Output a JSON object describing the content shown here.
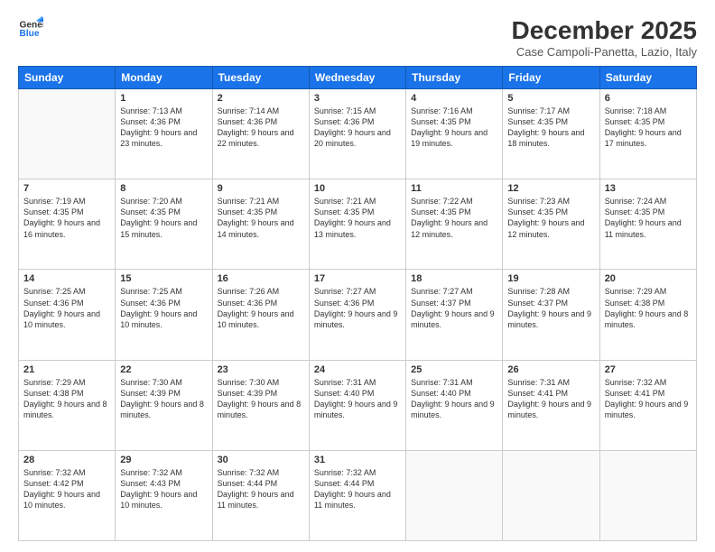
{
  "logo": {
    "line1": "General",
    "line2": "Blue"
  },
  "header": {
    "month": "December 2025",
    "location": "Case Campoli-Panetta, Lazio, Italy"
  },
  "weekdays": [
    "Sunday",
    "Monday",
    "Tuesday",
    "Wednesday",
    "Thursday",
    "Friday",
    "Saturday"
  ],
  "weeks": [
    [
      {
        "day": "",
        "sunrise": "",
        "sunset": "",
        "daylight": ""
      },
      {
        "day": "1",
        "sunrise": "Sunrise: 7:13 AM",
        "sunset": "Sunset: 4:36 PM",
        "daylight": "Daylight: 9 hours and 23 minutes."
      },
      {
        "day": "2",
        "sunrise": "Sunrise: 7:14 AM",
        "sunset": "Sunset: 4:36 PM",
        "daylight": "Daylight: 9 hours and 22 minutes."
      },
      {
        "day": "3",
        "sunrise": "Sunrise: 7:15 AM",
        "sunset": "Sunset: 4:36 PM",
        "daylight": "Daylight: 9 hours and 20 minutes."
      },
      {
        "day": "4",
        "sunrise": "Sunrise: 7:16 AM",
        "sunset": "Sunset: 4:35 PM",
        "daylight": "Daylight: 9 hours and 19 minutes."
      },
      {
        "day": "5",
        "sunrise": "Sunrise: 7:17 AM",
        "sunset": "Sunset: 4:35 PM",
        "daylight": "Daylight: 9 hours and 18 minutes."
      },
      {
        "day": "6",
        "sunrise": "Sunrise: 7:18 AM",
        "sunset": "Sunset: 4:35 PM",
        "daylight": "Daylight: 9 hours and 17 minutes."
      }
    ],
    [
      {
        "day": "7",
        "sunrise": "Sunrise: 7:19 AM",
        "sunset": "Sunset: 4:35 PM",
        "daylight": "Daylight: 9 hours and 16 minutes."
      },
      {
        "day": "8",
        "sunrise": "Sunrise: 7:20 AM",
        "sunset": "Sunset: 4:35 PM",
        "daylight": "Daylight: 9 hours and 15 minutes."
      },
      {
        "day": "9",
        "sunrise": "Sunrise: 7:21 AM",
        "sunset": "Sunset: 4:35 PM",
        "daylight": "Daylight: 9 hours and 14 minutes."
      },
      {
        "day": "10",
        "sunrise": "Sunrise: 7:21 AM",
        "sunset": "Sunset: 4:35 PM",
        "daylight": "Daylight: 9 hours and 13 minutes."
      },
      {
        "day": "11",
        "sunrise": "Sunrise: 7:22 AM",
        "sunset": "Sunset: 4:35 PM",
        "daylight": "Daylight: 9 hours and 12 minutes."
      },
      {
        "day": "12",
        "sunrise": "Sunrise: 7:23 AM",
        "sunset": "Sunset: 4:35 PM",
        "daylight": "Daylight: 9 hours and 12 minutes."
      },
      {
        "day": "13",
        "sunrise": "Sunrise: 7:24 AM",
        "sunset": "Sunset: 4:35 PM",
        "daylight": "Daylight: 9 hours and 11 minutes."
      }
    ],
    [
      {
        "day": "14",
        "sunrise": "Sunrise: 7:25 AM",
        "sunset": "Sunset: 4:36 PM",
        "daylight": "Daylight: 9 hours and 10 minutes."
      },
      {
        "day": "15",
        "sunrise": "Sunrise: 7:25 AM",
        "sunset": "Sunset: 4:36 PM",
        "daylight": "Daylight: 9 hours and 10 minutes."
      },
      {
        "day": "16",
        "sunrise": "Sunrise: 7:26 AM",
        "sunset": "Sunset: 4:36 PM",
        "daylight": "Daylight: 9 hours and 10 minutes."
      },
      {
        "day": "17",
        "sunrise": "Sunrise: 7:27 AM",
        "sunset": "Sunset: 4:36 PM",
        "daylight": "Daylight: 9 hours and 9 minutes."
      },
      {
        "day": "18",
        "sunrise": "Sunrise: 7:27 AM",
        "sunset": "Sunset: 4:37 PM",
        "daylight": "Daylight: 9 hours and 9 minutes."
      },
      {
        "day": "19",
        "sunrise": "Sunrise: 7:28 AM",
        "sunset": "Sunset: 4:37 PM",
        "daylight": "Daylight: 9 hours and 9 minutes."
      },
      {
        "day": "20",
        "sunrise": "Sunrise: 7:29 AM",
        "sunset": "Sunset: 4:38 PM",
        "daylight": "Daylight: 9 hours and 8 minutes."
      }
    ],
    [
      {
        "day": "21",
        "sunrise": "Sunrise: 7:29 AM",
        "sunset": "Sunset: 4:38 PM",
        "daylight": "Daylight: 9 hours and 8 minutes."
      },
      {
        "day": "22",
        "sunrise": "Sunrise: 7:30 AM",
        "sunset": "Sunset: 4:39 PM",
        "daylight": "Daylight: 9 hours and 8 minutes."
      },
      {
        "day": "23",
        "sunrise": "Sunrise: 7:30 AM",
        "sunset": "Sunset: 4:39 PM",
        "daylight": "Daylight: 9 hours and 8 minutes."
      },
      {
        "day": "24",
        "sunrise": "Sunrise: 7:31 AM",
        "sunset": "Sunset: 4:40 PM",
        "daylight": "Daylight: 9 hours and 9 minutes."
      },
      {
        "day": "25",
        "sunrise": "Sunrise: 7:31 AM",
        "sunset": "Sunset: 4:40 PM",
        "daylight": "Daylight: 9 hours and 9 minutes."
      },
      {
        "day": "26",
        "sunrise": "Sunrise: 7:31 AM",
        "sunset": "Sunset: 4:41 PM",
        "daylight": "Daylight: 9 hours and 9 minutes."
      },
      {
        "day": "27",
        "sunrise": "Sunrise: 7:32 AM",
        "sunset": "Sunset: 4:41 PM",
        "daylight": "Daylight: 9 hours and 9 minutes."
      }
    ],
    [
      {
        "day": "28",
        "sunrise": "Sunrise: 7:32 AM",
        "sunset": "Sunset: 4:42 PM",
        "daylight": "Daylight: 9 hours and 10 minutes."
      },
      {
        "day": "29",
        "sunrise": "Sunrise: 7:32 AM",
        "sunset": "Sunset: 4:43 PM",
        "daylight": "Daylight: 9 hours and 10 minutes."
      },
      {
        "day": "30",
        "sunrise": "Sunrise: 7:32 AM",
        "sunset": "Sunset: 4:44 PM",
        "daylight": "Daylight: 9 hours and 11 minutes."
      },
      {
        "day": "31",
        "sunrise": "Sunrise: 7:32 AM",
        "sunset": "Sunset: 4:44 PM",
        "daylight": "Daylight: 9 hours and 11 minutes."
      },
      {
        "day": "",
        "sunrise": "",
        "sunset": "",
        "daylight": ""
      },
      {
        "day": "",
        "sunrise": "",
        "sunset": "",
        "daylight": ""
      },
      {
        "day": "",
        "sunrise": "",
        "sunset": "",
        "daylight": ""
      }
    ]
  ]
}
